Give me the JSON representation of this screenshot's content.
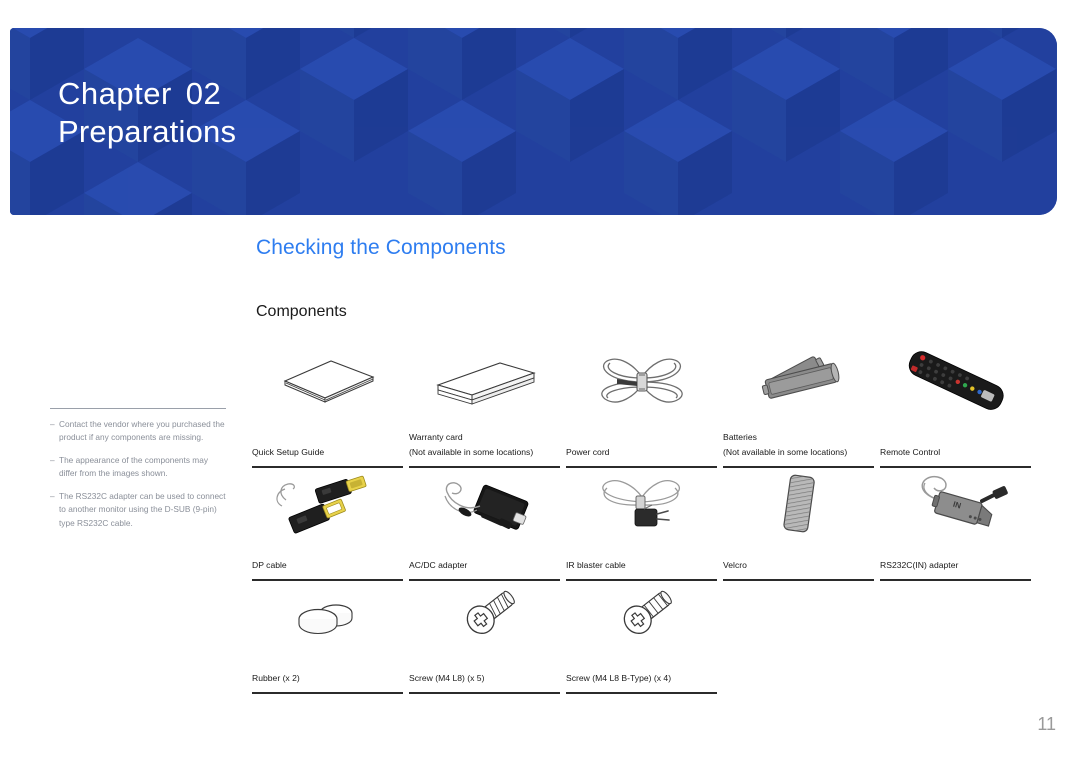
{
  "banner": {
    "chapter_word": "Chapter",
    "chapter_number": "02",
    "chapter_name": "Preparations",
    "background_color": "#22409E"
  },
  "headings": {
    "section_title": "Checking the Components",
    "section_title_color": "#2E7DF0",
    "sub_title": "Components"
  },
  "notes": [
    {
      "marker": "–",
      "text": "Contact the vendor where you purchased the product if any components are missing."
    },
    {
      "marker": "–",
      "text": "The appearance of the components may differ from the images shown."
    },
    {
      "marker": "–",
      "text": "The RS232C adapter can be used to connect to another monitor using the D-SUB (9-pin) type RS232C cable."
    }
  ],
  "components": {
    "rows": [
      [
        {
          "label": "Quick Setup Guide",
          "icon": "quick-setup-guide-icon"
        },
        {
          "label": "Warranty card\n(Not available in some locations)",
          "icon": "warranty-card-icon"
        },
        {
          "label": "Power cord",
          "icon": "power-cord-icon"
        },
        {
          "label": "Batteries\n(Not available in some locations)",
          "icon": "batteries-icon"
        },
        {
          "label": "Remote Control",
          "icon": "remote-control-icon"
        }
      ],
      [
        {
          "label": "DP cable",
          "icon": "dp-cable-icon"
        },
        {
          "label": "AC/DC adapter",
          "icon": "ac-dc-adapter-icon"
        },
        {
          "label": "IR blaster cable",
          "icon": "ir-blaster-cable-icon"
        },
        {
          "label": "Velcro",
          "icon": "velcro-icon"
        },
        {
          "label": "RS232C(IN) adapter",
          "icon": "rs232c-adapter-icon"
        }
      ],
      [
        {
          "label": "Rubber (x 2)",
          "icon": "rubber-icon"
        },
        {
          "label": "Screw (M4 L8) (x 5)",
          "icon": "screw-m4l8-icon"
        },
        {
          "label": "Screw (M4 L8 B-Type) (x 4)",
          "icon": "screw-m4l8-btype-icon"
        },
        {
          "label": "",
          "icon": ""
        },
        {
          "label": "",
          "icon": ""
        }
      ]
    ]
  },
  "footer": {
    "page_number": "11"
  }
}
